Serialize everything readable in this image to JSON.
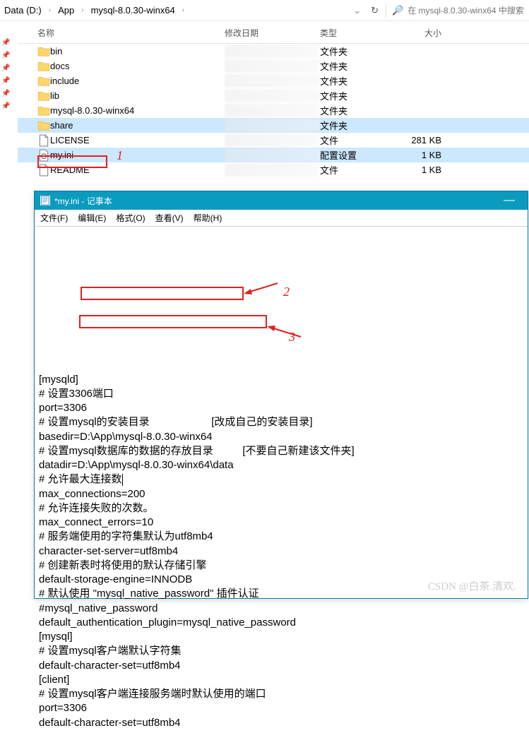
{
  "breadcrumb": {
    "items": [
      "Data (D:)",
      "App",
      "mysql-8.0.30-winx64"
    ]
  },
  "search": {
    "placeholder": "在 mysql-8.0.30-winx64 中搜索"
  },
  "columns": {
    "name": "名称",
    "date": "修改日期",
    "type": "类型",
    "size": "大小"
  },
  "files": [
    {
      "name": "bin",
      "type": "文件夹",
      "size": "",
      "icon": "folder"
    },
    {
      "name": "docs",
      "type": "文件夹",
      "size": "",
      "icon": "folder"
    },
    {
      "name": "include",
      "type": "文件夹",
      "size": "",
      "icon": "folder"
    },
    {
      "name": "lib",
      "type": "文件夹",
      "size": "",
      "icon": "folder"
    },
    {
      "name": "mysql-8.0.30-winx64",
      "type": "文件夹",
      "size": "",
      "icon": "folder"
    },
    {
      "name": "share",
      "type": "文件夹",
      "size": "",
      "icon": "folder",
      "selected": true
    },
    {
      "name": "LICENSE",
      "type": "文件",
      "size": "281 KB",
      "icon": "file"
    },
    {
      "name": "my.ini",
      "type": "配置设置",
      "size": "1 KB",
      "icon": "ini",
      "selected": true
    },
    {
      "name": "README",
      "type": "文件",
      "size": "1 KB",
      "icon": "file"
    }
  ],
  "annotations": {
    "one": "1",
    "two": "2",
    "three": "3"
  },
  "notepad": {
    "title": "*my.ini - 记事本",
    "menu": [
      "文件(F)",
      "编辑(E)",
      "格式(O)",
      "查看(V)",
      "帮助(H)"
    ],
    "lines": [
      "[mysqld]",
      "# 设置3306端口",
      "port=3306",
      "# 设置mysql的安装目录                     [改成自己的安装目录]",
      "basedir=D:\\App\\mysql-8.0.30-winx64",
      "# 设置mysql数据库的数据的存放目录          [不要自己新建该文件夹]",
      "datadir=D:\\App\\mysql-8.0.30-winx64\\data",
      "# 允许最大连接数",
      "max_connections=200",
      "# 允许连接失败的次数。",
      "max_connect_errors=10",
      "# 服务端使用的字符集默认为utf8mb4",
      "character-set-server=utf8mb4",
      "# 创建新表时将使用的默认存储引擎",
      "default-storage-engine=INNODB",
      "# 默认使用 \"mysql_native_password\" 插件认证",
      "#mysql_native_password",
      "default_authentication_plugin=mysql_native_password",
      "[mysql]",
      "# 设置mysql客户端默认字符集",
      "default-character-set=utf8mb4",
      "[client]",
      "# 设置mysql客户端连接服务端时默认使用的端口",
      "port=3306",
      "default-character-set=utf8mb4"
    ]
  },
  "watermark": "CSDN @白茶.清欢."
}
